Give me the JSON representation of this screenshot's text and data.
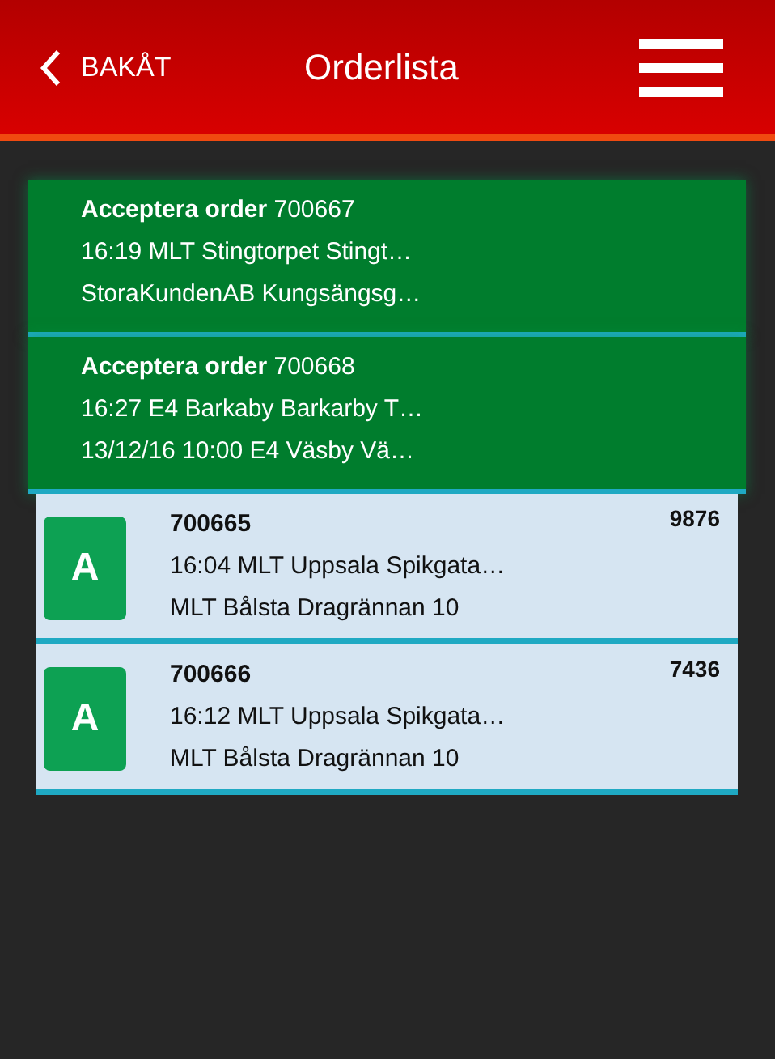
{
  "header": {
    "back_label": "BAKÅT",
    "title": "Orderlista"
  },
  "orders": [
    {
      "kind": "pending",
      "heading": "**Acceptera order** 700667",
      "line1": "16:19 MLT Stingtorpet Stingt…",
      "line2": "StoraKundenAB Kungsängsg…"
    },
    {
      "kind": "pending",
      "heading": "**Acceptera order** 700668",
      "line1": "16:27 E4 Barkaby Barkarby T…",
      "line2": "13/12/16 10:00 E4 Väsby Vä…"
    },
    {
      "kind": "accepted",
      "badge": "A",
      "heading": "700665",
      "code": "9876",
      "line1": "16:04 MLT Uppsala Spikgata…",
      "line2": "MLT Bålsta Dragrännan 10"
    },
    {
      "kind": "accepted",
      "badge": "A",
      "heading": "700666",
      "code": "7436",
      "line1": "16:12 MLT Uppsala Spikgata…",
      "line2": "MLT Bålsta Dragrännan 10"
    }
  ]
}
